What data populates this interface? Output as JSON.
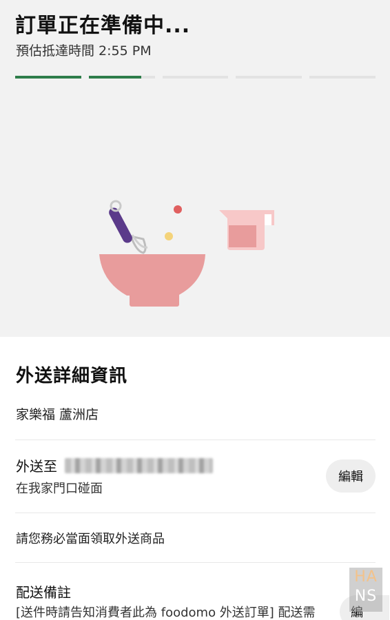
{
  "header": {
    "title": "訂單正在準備中...",
    "eta": "預估抵達時間 2:55 PM"
  },
  "progress": {
    "segments": 5,
    "fills": [
      1,
      0.8,
      0,
      0,
      0
    ],
    "active_color": "#2e7d4a",
    "inactive_color": "#e3e3e3"
  },
  "illustration": {
    "name": "cooking-bowl-whisk-measuring-cup",
    "colors": {
      "bowl": "#e89c9c",
      "whisk_handle": "#5b3a8a",
      "dot_red": "#e06060",
      "dot_yellow": "#f4d37a",
      "cup": "#f0a8a8"
    }
  },
  "details": {
    "section_title": "外送詳細資訊",
    "store_name": "家樂福 蘆洲店",
    "delivery_to_label": "外送至",
    "delivery_instruction": "在我家門口碰面",
    "edit_label": "編輯",
    "notice": "請您務必當面領取外送商品",
    "note_title": "配送備註",
    "note_text": "[送件時請告知消費者此為 foodomo 外送訂單] 配送需",
    "note_edit_label": "編"
  },
  "watermark": {
    "line1": "HA",
    "line2": "NS"
  }
}
